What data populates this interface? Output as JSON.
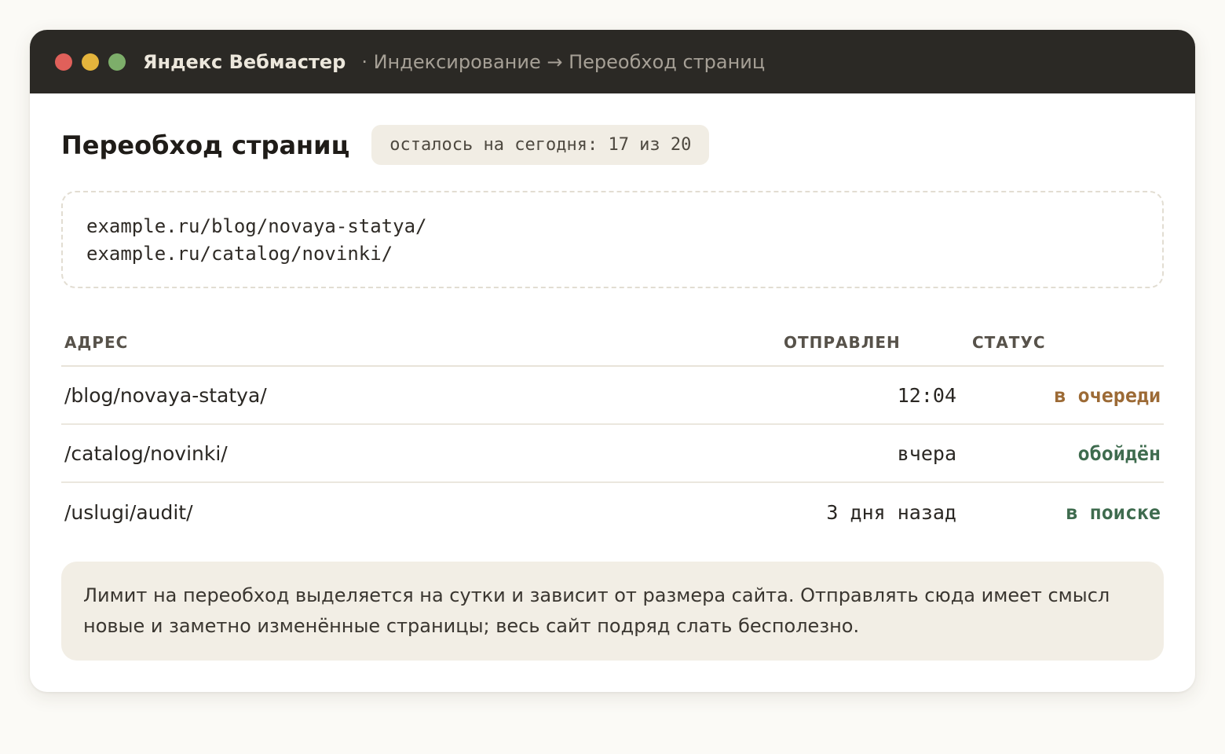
{
  "window": {
    "app_title": "Яндекс Вебмастер",
    "breadcrumb": "· Индексирование → Переобход страниц",
    "controls": {
      "close_color": "#e0605a",
      "minimize_color": "#e4b43c",
      "maximize_color": "#7dae6a"
    }
  },
  "page": {
    "title": "Переобход страниц",
    "quota": "осталось на сегодня: 17 из 20"
  },
  "url_input": {
    "value": "example.ru/blog/novaya-statya/\nexample.ru/catalog/novinki/"
  },
  "table": {
    "headers": {
      "address": "АДРЕС",
      "sent": "ОТПРАВЛЕН",
      "status": "СТАТУС"
    },
    "rows": [
      {
        "address": "/blog/novaya-statya/",
        "sent": "12:04",
        "status": "в очереди",
        "status_color": "#9c6a35"
      },
      {
        "address": "/catalog/novinki/",
        "sent": "вчера",
        "status": "обойдён",
        "status_color": "#3e6b4e"
      },
      {
        "address": "/uslugi/audit/",
        "sent": "3 дня назад",
        "status": "в поиске",
        "status_color": "#3e6b4e"
      }
    ]
  },
  "note": {
    "text": "Лимит на переобход выделяется на сутки и зависит от размера сайта. Отправлять сюда имеет смысл новые и заметно изменённые страницы; весь сайт подряд слать бесполезно."
  }
}
